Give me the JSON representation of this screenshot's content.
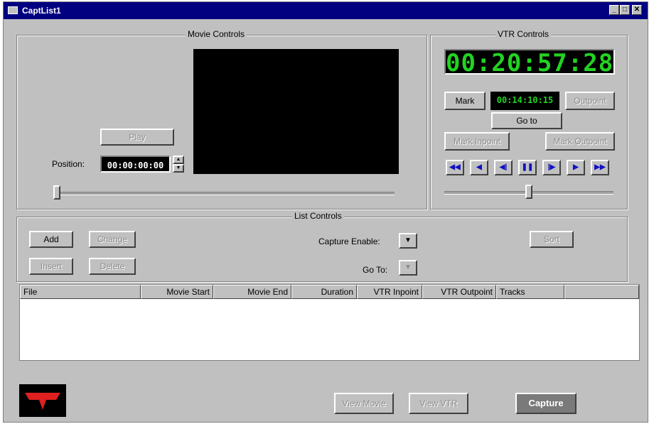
{
  "window": {
    "title": "CaptList1",
    "minimize": "_",
    "maximize": "□",
    "close": "✕"
  },
  "movie_controls": {
    "group_label": "Movie Controls",
    "play_label": "Play",
    "position_label": "Position:",
    "position_value": "00:00:00:00",
    "scrubber_level": 0.0
  },
  "vtr_controls": {
    "group_label": "VTR Controls",
    "timecode": "00:20:57:28",
    "mark_label": "Mark",
    "inpoint_value": "00:14:10:15",
    "outpoint_label": "Outpoint",
    "goto_label": "Go to",
    "mark_inpoint_label": "Mark Inpoint",
    "mark_outpoint_label": "Mark Outpoint",
    "transport": [
      {
        "name": "rewind-icon",
        "glyph": "◀◀"
      },
      {
        "name": "play-reverse-icon",
        "glyph": "◀"
      },
      {
        "name": "step-back-icon",
        "glyph": "◀|"
      },
      {
        "name": "pause-icon",
        "glyph": "❚❚"
      },
      {
        "name": "step-forward-icon",
        "glyph": "|▶"
      },
      {
        "name": "play-icon",
        "glyph": "▶"
      },
      {
        "name": "fast-forward-icon",
        "glyph": "▶▶"
      }
    ],
    "shuttle_level": 0.5
  },
  "list_controls": {
    "group_label": "List Controls",
    "add_label": "Add",
    "change_label": "Change",
    "insert_label": "Insert",
    "delete_label": "Delete",
    "capture_enable_label": "Capture Enable:",
    "goto_label": "Go To:",
    "sort_label": "Sort"
  },
  "list": {
    "columns": [
      "File",
      "Movie Start",
      "Movie End",
      "Duration",
      "VTR Inpoint",
      "VTR Outpoint",
      "Tracks"
    ],
    "rows": []
  },
  "footer": {
    "view_movie_label": "View Movie",
    "view_vtr_label": "View VTR",
    "capture_label": "Capture"
  },
  "colors": {
    "title_bar": "#000080",
    "lcd_text": "#22d322",
    "face": "#c0c0c0",
    "logo_red": "#e02020"
  }
}
